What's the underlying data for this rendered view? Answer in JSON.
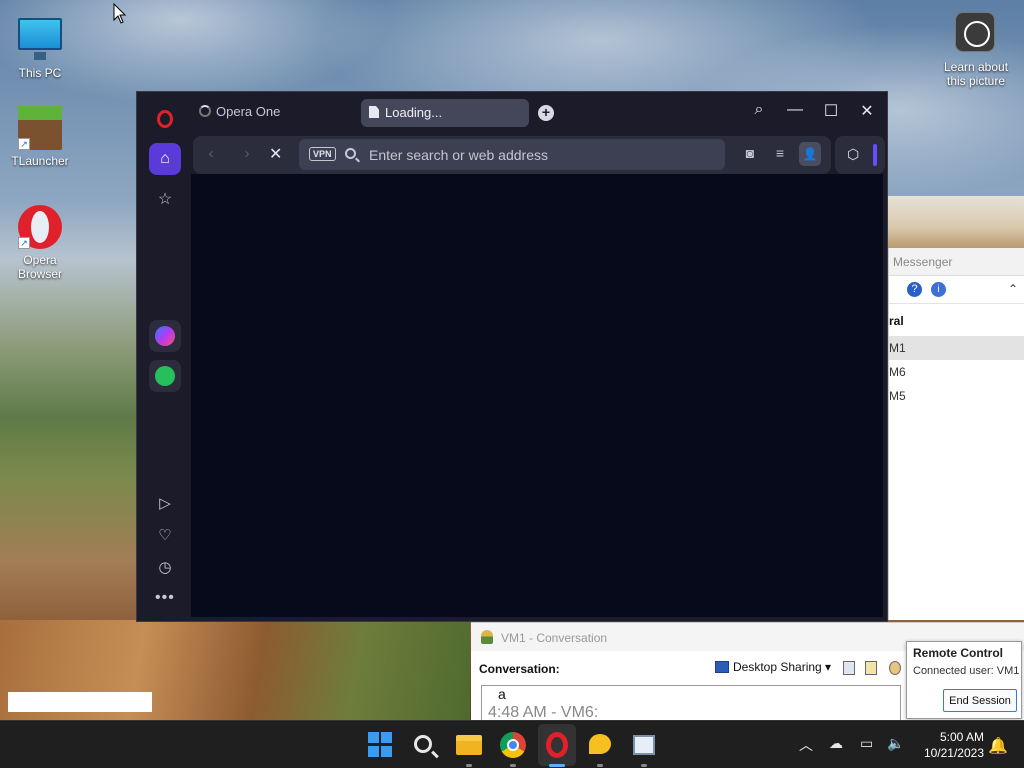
{
  "desktop": {
    "icons": [
      {
        "label": "This PC"
      },
      {
        "label": "TLauncher"
      },
      {
        "label": "Opera Browser"
      }
    ],
    "learn_label": "Learn about this picture"
  },
  "messenger": {
    "title": "Messenger",
    "group": "ral",
    "rows": [
      "M1",
      "M6",
      "M5"
    ]
  },
  "opera": {
    "workspace": "Opera One",
    "tab_title": "Loading...",
    "vpn_label": "VPN",
    "address_placeholder": "Enter search or web address",
    "address_value": ""
  },
  "conversation": {
    "title": "VM1 - Conversation",
    "label": "Conversation:",
    "desktop_sharing": "Desktop Sharing",
    "message_text": "a",
    "message_time": "4:48 AM - VM6:"
  },
  "remote_control": {
    "title": "Remote Control",
    "connected": "Connected user: VM1",
    "end_session": "End Session"
  },
  "taskbar": {
    "time": "5:00 AM",
    "date": "10/21/2023"
  },
  "colors": {
    "opera_red": "#e0202a",
    "opera_accent": "#5a3bd9",
    "viewport_bg": "#070a1b",
    "taskbar_bg": "#1f1f1f"
  }
}
